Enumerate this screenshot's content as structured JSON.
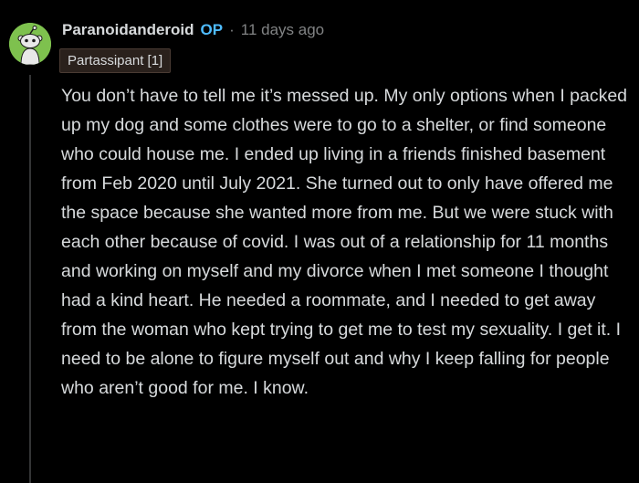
{
  "comment": {
    "avatar_icon": "reddit-snoo-avatar-icon",
    "avatar_color": "#7ec14e",
    "username": "Paranoidanderoid",
    "op_badge": "OP",
    "separator": "·",
    "timestamp": "11 days ago",
    "flair": "Partassipant [1]",
    "body": "You don’t have to tell me it’s messed up. My only options when I packed up my dog and some clothes were to go to a shelter, or find someone who could house me. I ended up living in a friends finished basement from Feb 2020 until July 2021. She turned out to only have offered me the space because she wanted more from me. But we were stuck with each other because of covid. I was out of a relationship for 11 months and working on myself and my divorce when I met someone I thought had a kind heart. He needed a roommate, and I needed to get away from the woman who kept trying to get me to test my sexuality. I get it. I need to be alone to figure myself out and why I keep falling for people who aren’t good for me. I know."
  },
  "colors": {
    "background": "#000000",
    "text": "#d7dadc",
    "meta": "#818384",
    "op_accent": "#4fbcff",
    "thread_line": "#343536"
  }
}
